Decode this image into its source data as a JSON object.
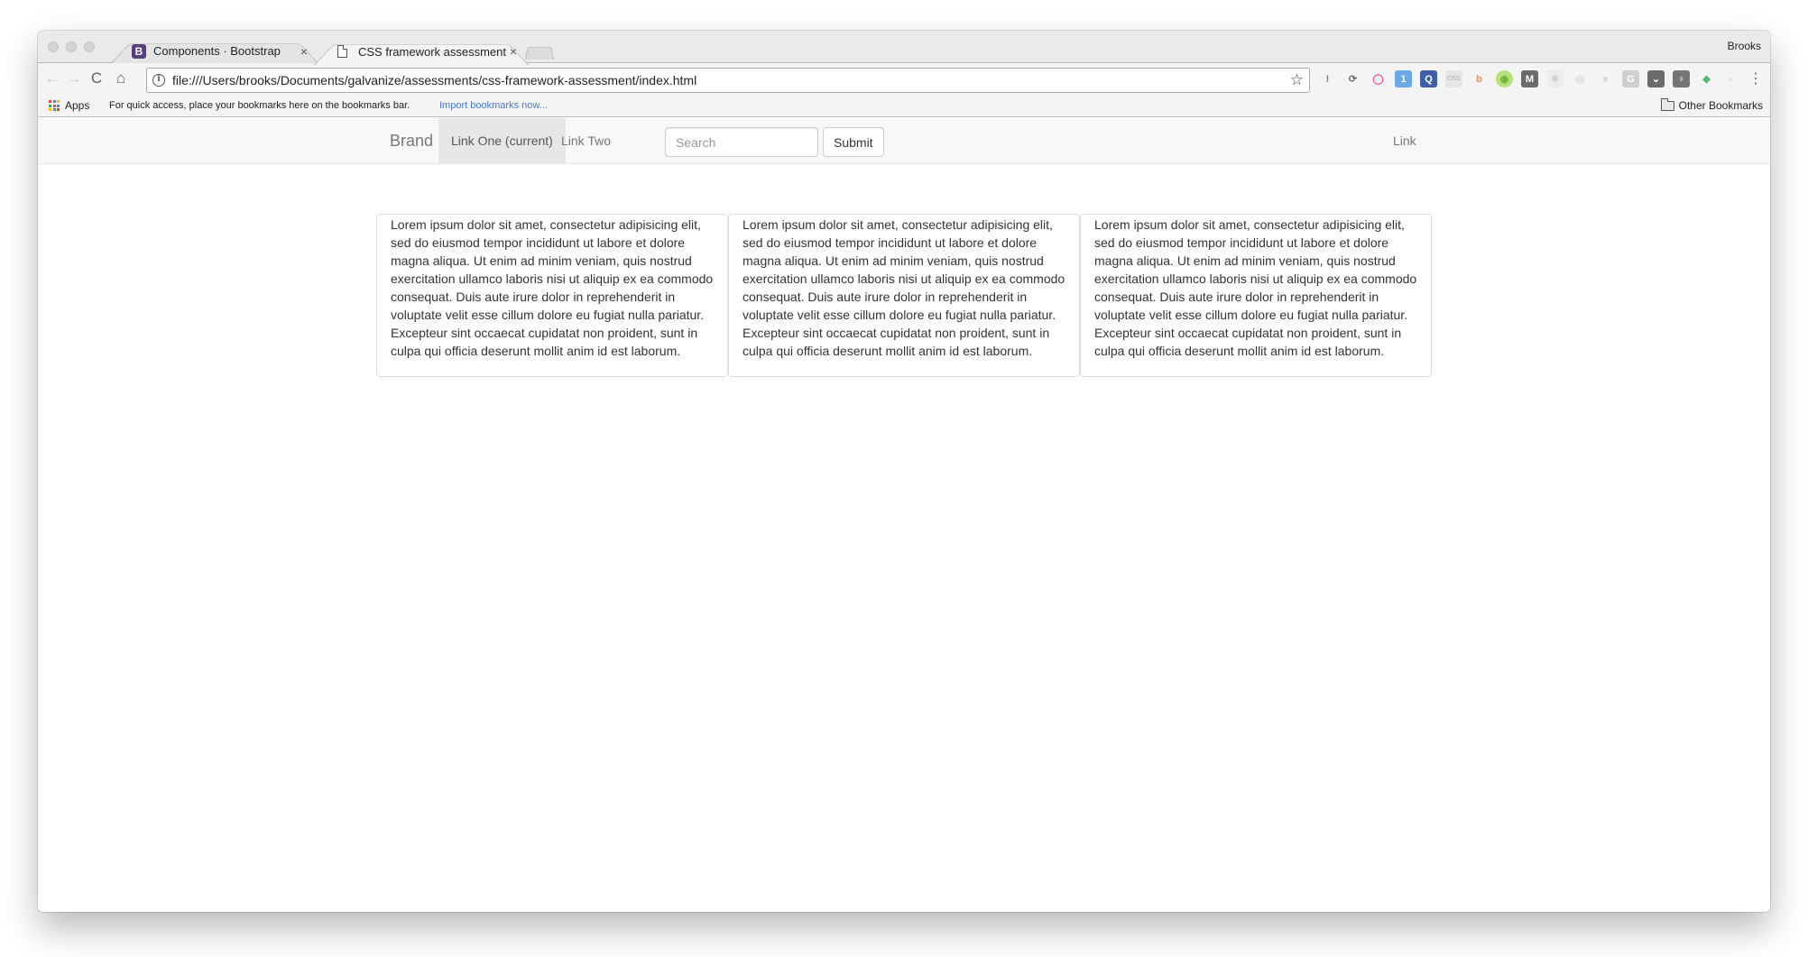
{
  "browser": {
    "tabs": [
      {
        "title": "Components · Bootstrap",
        "favicon": "bootstrap-b-icon",
        "favicon_text": "B",
        "active": false
      },
      {
        "title": "CSS framework assessment",
        "favicon": "document-icon",
        "active": true
      }
    ],
    "close_glyph": "×",
    "profile_name": "Brooks",
    "toolbar": {
      "back_glyph": "←",
      "forward_glyph": "→",
      "reload_glyph": "C",
      "home_glyph": "⌂",
      "info_glyph": "i",
      "url": "file:///Users/brooks/Documents/galvanize/assessments/css-framework-assessment/index.html",
      "star_glyph": "☆",
      "menu_glyph": "⋮"
    },
    "extensions": [
      {
        "name": "1password-icon",
        "glyph": "!",
        "color": "#7a7a7a",
        "bg": "transparent",
        "shape": "circle"
      },
      {
        "name": "sync-icon",
        "glyph": "⟳",
        "color": "#6a6a6a",
        "bg": "transparent",
        "shape": "circle"
      },
      {
        "name": "color-wheel-icon",
        "glyph": "◯",
        "color": "#e84b8a",
        "bg": "transparent",
        "shape": "circle"
      },
      {
        "name": "bird-badge-icon",
        "glyph": "1",
        "color": "#ffffff",
        "bg": "#6aa8e8",
        "shape": "square"
      },
      {
        "name": "q-icon",
        "glyph": "Q",
        "color": "#ffffff",
        "bg": "#3f5ea8",
        "shape": "square"
      },
      {
        "name": "css-icon",
        "glyph": "CSS",
        "color": "#bbbbbb",
        "bg": "#e6e6e6",
        "shape": "square"
      },
      {
        "name": "b-circle-icon",
        "glyph": "b",
        "color": "#f08a4b",
        "bg": "transparent",
        "shape": "circle"
      },
      {
        "name": "monster-icon",
        "glyph": "◉",
        "color": "#6fb43a",
        "bg": "#b8e27a",
        "shape": "circle"
      },
      {
        "name": "m-icon",
        "glyph": "M",
        "color": "#ffffff",
        "bg": "#6b6b6b",
        "shape": "square"
      },
      {
        "name": "react-icon",
        "glyph": "⚛",
        "color": "#c9c9c9",
        "bg": "#ececec",
        "shape": "square"
      },
      {
        "name": "target-icon",
        "glyph": "◎",
        "color": "#d5d5d5",
        "bg": "transparent",
        "shape": "circle"
      },
      {
        "name": "cube-icon",
        "glyph": "■",
        "color": "#dcdcdc",
        "bg": "transparent",
        "shape": "square"
      },
      {
        "name": "g-icon",
        "glyph": "G",
        "color": "#ffffff",
        "bg": "#cfcfcf",
        "shape": "square"
      },
      {
        "name": "pocket-icon",
        "glyph": "⌄",
        "color": "#ffffff",
        "bg": "#6b6b6b",
        "shape": "square"
      },
      {
        "name": "lightbulb-icon",
        "glyph": "♀",
        "color": "#ffffff",
        "bg": "#757575",
        "shape": "square"
      },
      {
        "name": "feedly-icon",
        "glyph": "◆",
        "color": "#4cbb6c",
        "bg": "transparent",
        "shape": "square"
      },
      {
        "name": "crescent-icon",
        "glyph": "◐",
        "color": "#e0e0e0",
        "bg": "transparent",
        "shape": "circle"
      }
    ],
    "bookmarks": {
      "apps_label": "Apps",
      "apps_colors": [
        "#e8453c",
        "#4285f4",
        "#fbbc05",
        "#34a853",
        "#e8453c",
        "#4285f4",
        "#fbbc05",
        "#34a853",
        "#e8453c"
      ],
      "hint": "For quick access, place your bookmarks here on the bookmarks bar.",
      "import_link": "Import bookmarks now...",
      "other_bookmarks": "Other Bookmarks"
    }
  },
  "page": {
    "navbar": {
      "brand": "Brand",
      "links": [
        {
          "label": "Link One (current)",
          "active": true
        },
        {
          "label": "Link Two",
          "active": false
        }
      ],
      "search": {
        "placeholder": "Search",
        "value": ""
      },
      "submit_label": "Submit",
      "right_link": "Link"
    },
    "cards": [
      {
        "text": "Lorem ipsum dolor sit amet, consectetur adipisicing elit, sed do eiusmod tempor incididunt ut labore et dolore magna aliqua. Ut enim ad minim veniam, quis nostrud exercitation ullamco laboris nisi ut aliquip ex ea commodo consequat. Duis aute irure dolor in reprehenderit in voluptate velit esse cillum dolore eu fugiat nulla pariatur. Excepteur sint occaecat cupidatat non proident, sunt in culpa qui officia deserunt mollit anim id est laborum."
      },
      {
        "text": "Lorem ipsum dolor sit amet, consectetur adipisicing elit, sed do eiusmod tempor incididunt ut labore et dolore magna aliqua. Ut enim ad minim veniam, quis nostrud exercitation ullamco laboris nisi ut aliquip ex ea commodo consequat. Duis aute irure dolor in reprehenderit in voluptate velit esse cillum dolore eu fugiat nulla pariatur. Excepteur sint occaecat cupidatat non proident, sunt in culpa qui officia deserunt mollit anim id est laborum."
      },
      {
        "text": "Lorem ipsum dolor sit amet, consectetur adipisicing elit, sed do eiusmod tempor incididunt ut labore et dolore magna aliqua. Ut enim ad minim veniam, quis nostrud exercitation ullamco laboris nisi ut aliquip ex ea commodo consequat. Duis aute irure dolor in reprehenderit in voluptate velit esse cillum dolore eu fugiat nulla pariatur. Excepteur sint occaecat cupidatat non proident, sunt in culpa qui officia deserunt mollit anim id est laborum."
      }
    ]
  }
}
